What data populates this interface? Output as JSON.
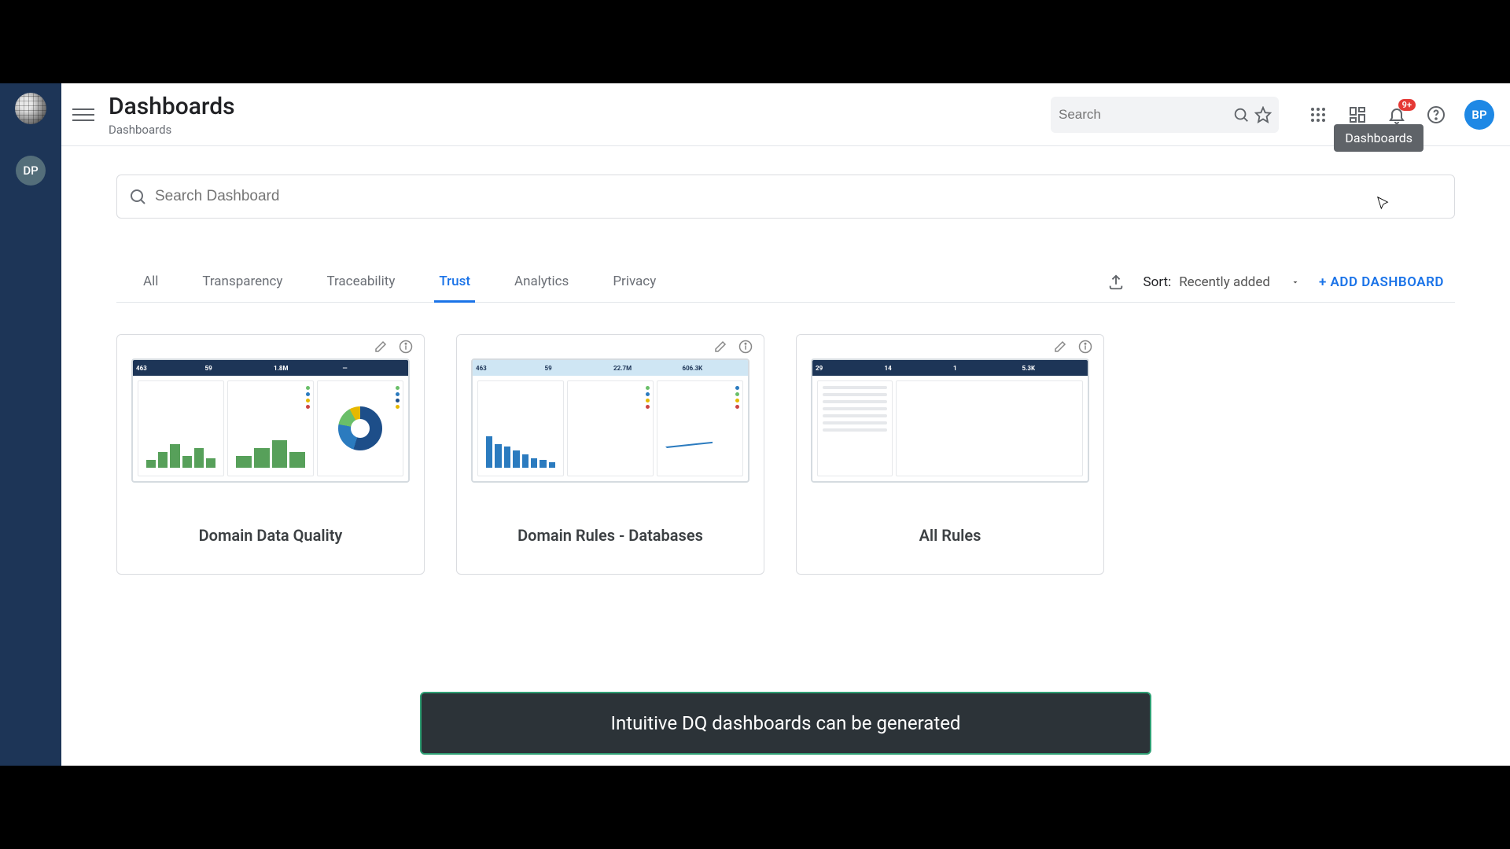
{
  "header": {
    "title": "Dashboards",
    "breadcrumb": "Dashboards",
    "search_placeholder": "Search",
    "notification_badge": "9+",
    "avatar_initials": "BP",
    "tooltip": "Dashboards"
  },
  "sidebar": {
    "avatar_initials": "DP"
  },
  "content": {
    "search_placeholder": "Search Dashboard",
    "tabs": [
      "All",
      "Transparency",
      "Traceability",
      "Trust",
      "Analytics",
      "Privacy"
    ],
    "active_tab_index": 3,
    "sort_label": "Sort:",
    "sort_value": "Recently added",
    "add_button": "+ ADD DASHBOARD"
  },
  "cards": [
    {
      "title": "Domain Data Quality",
      "thumb_style": "dark",
      "kpis": [
        "463",
        "59",
        "1.8M",
        "—"
      ]
    },
    {
      "title": "Domain Rules - Databases",
      "thumb_style": "light",
      "kpis": [
        "463",
        "59",
        "22.7M",
        "606.3K"
      ]
    },
    {
      "title": "All Rules",
      "thumb_style": "dark",
      "kpis": [
        "29",
        "14",
        "1",
        "5.3K"
      ]
    }
  ],
  "caption": "Intuitive DQ dashboards can be generated"
}
